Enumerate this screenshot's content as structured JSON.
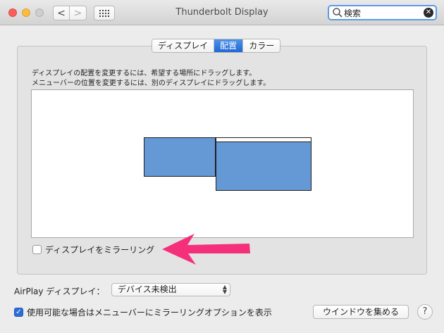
{
  "window": {
    "title": "Thunderbolt Display",
    "nav_back": "<",
    "nav_forward": ">"
  },
  "search": {
    "value": "検索",
    "clear_glyph": "✕"
  },
  "tabs": [
    {
      "label": "ディスプレイ",
      "selected": false
    },
    {
      "label": "配置",
      "selected": true
    },
    {
      "label": "カラー",
      "selected": false
    }
  ],
  "arrangement": {
    "hint_line1": "ディスプレイの配置を変更するには、希望する場所にドラッグします。",
    "hint_line2": "メニューバーの位置を変更するには、別のディスプレイにドラッグします。"
  },
  "mirror": {
    "label": "ディスプレイをミラーリング",
    "checked": false
  },
  "airplay": {
    "label": "AirPlay ディスプレイ：",
    "selected": "デバイス未検出"
  },
  "menu_option": {
    "label": "使用可能な場合はメニューバーにミラーリングオプションを表示",
    "checked": true,
    "check_glyph": "✓"
  },
  "buttons": {
    "gather_windows": "ウインドウを集める",
    "help": "?"
  },
  "colors": {
    "accent": "#2c6ed6",
    "display_blue": "#6599d6",
    "arrow_pink": "#f5307a"
  }
}
